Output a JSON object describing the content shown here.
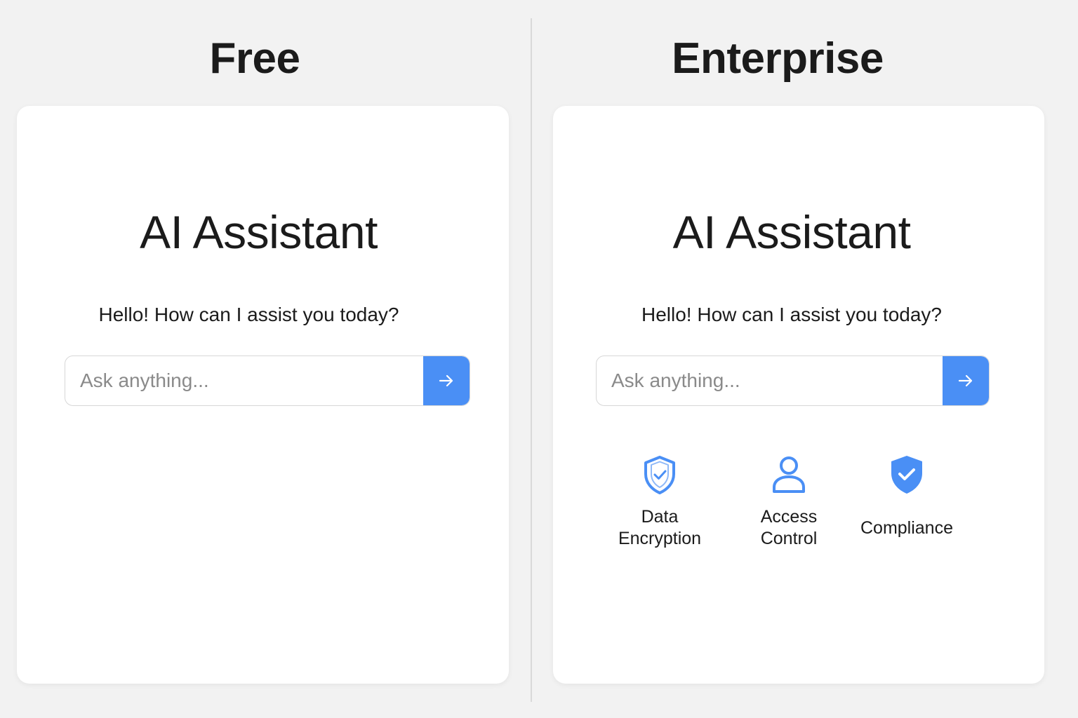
{
  "free": {
    "plan_title": "Free",
    "app_title": "AI Assistant",
    "greeting": "Hello! How can I assist you today?",
    "search": {
      "placeholder": "Ask anything..."
    }
  },
  "enterprise": {
    "plan_title": "Enterprise",
    "app_title": "AI Assistant",
    "greeting": "Hello! How can I assist you today?",
    "search": {
      "placeholder": "Ask anything..."
    },
    "features": [
      {
        "icon": "shield-check-outline-icon",
        "label_lines": [
          "Data",
          "Encryption"
        ]
      },
      {
        "icon": "user-icon",
        "label_lines": [
          "Access",
          "Control"
        ]
      },
      {
        "icon": "shield-check-filled-icon",
        "label_lines": [
          "Compliance"
        ]
      }
    ]
  },
  "colors": {
    "accent": "#4a8ff5",
    "page_background": "#f2f2f2",
    "card_background": "#ffffff"
  }
}
